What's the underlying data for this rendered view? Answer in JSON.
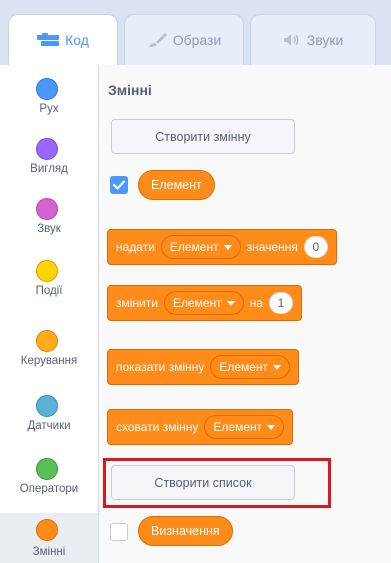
{
  "tabs": [
    {
      "label": "Код",
      "icon": "code-icon"
    },
    {
      "label": "Образи",
      "icon": "costume-brush-icon"
    },
    {
      "label": "Звуки",
      "icon": "speaker-icon"
    }
  ],
  "categories": [
    {
      "label": "Рух",
      "color": "#4c97ff"
    },
    {
      "label": "Вигляд",
      "color": "#9966ff"
    },
    {
      "label": "Звук",
      "color": "#cf63cf"
    },
    {
      "label": "Події",
      "color": "#ffd500"
    },
    {
      "label": "Керування",
      "color": "#ffab19"
    },
    {
      "label": "Датчики",
      "color": "#5cb1d6"
    },
    {
      "label": "Оператори",
      "color": "#59c059"
    },
    {
      "label": "Змінні",
      "color": "#ff8c1a"
    }
  ],
  "palette": {
    "title": "Змінні",
    "make_variable_label": "Створити змінну",
    "variable_name": "Елемент",
    "blocks": {
      "set": {
        "verb": "надати",
        "var": "Елемент",
        "mid": "значення",
        "value": "0"
      },
      "change": {
        "verb": "змінити",
        "var": "Елемент",
        "mid": "на",
        "value": "1"
      },
      "show": {
        "verb": "показати змінну",
        "var": "Елемент"
      },
      "hide": {
        "verb": "сховати змінну",
        "var": "Елемент"
      }
    },
    "make_list_label": "Створити список",
    "definition_label": "Визначення"
  },
  "colors": {
    "accent": "#4c97ff",
    "variables_orange": "#ff8c1a",
    "highlight_red": "#e0161f"
  }
}
